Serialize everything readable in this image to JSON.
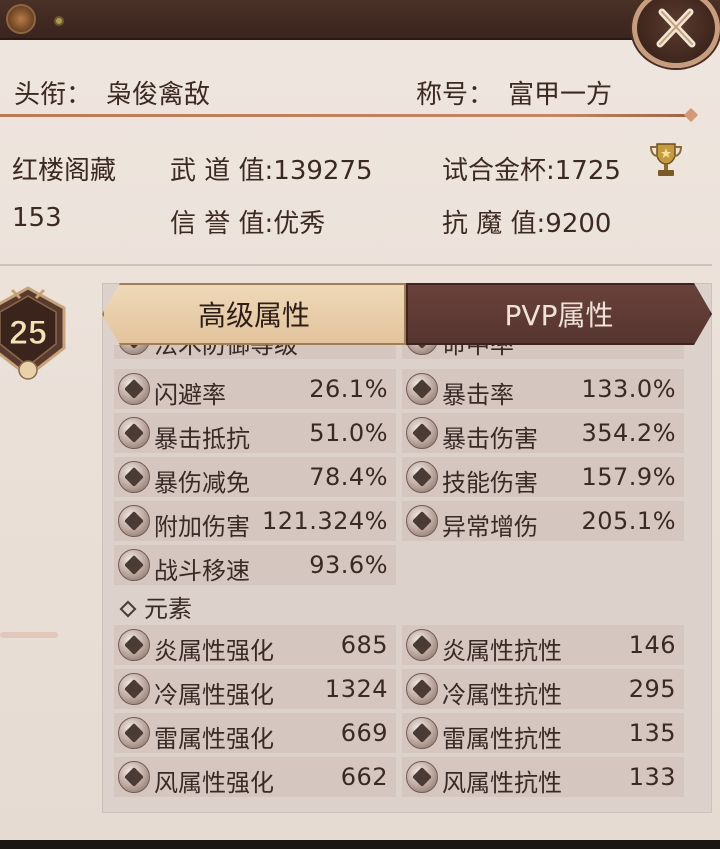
{
  "header": {
    "title_label": "头衔：",
    "title_value": "枭俊禽敌",
    "honor_label": "称号：",
    "honor_value": "富甲一方"
  },
  "info": {
    "row1": {
      "c1": "红楼阁藏",
      "c2": "武 道 值:139275",
      "c3": "试合金杯:1725"
    },
    "row2": {
      "c1": "153",
      "c2": "信 誉 值:优秀",
      "c3": "抗 魔 值:9200"
    }
  },
  "level": "25",
  "tabs": {
    "advanced": "高级属性",
    "pvp": "PVP属性"
  },
  "partial_row": {
    "left": "法术防御等级",
    "right": "命中率"
  },
  "stats": [
    {
      "left_label": "闪避率",
      "left_value": "26.1%",
      "right_label": "暴击率",
      "right_value": "133.0%"
    },
    {
      "left_label": "暴击抵抗",
      "left_value": "51.0%",
      "right_label": "暴击伤害",
      "right_value": "354.2%"
    },
    {
      "left_label": "暴伤减免",
      "left_value": "78.4%",
      "right_label": "技能伤害",
      "right_value": "157.9%"
    },
    {
      "left_label": "附加伤害",
      "left_value": "121.324%",
      "right_label": "异常增伤",
      "right_value": "205.1%"
    },
    {
      "left_label": "战斗移速",
      "left_value": "93.6%"
    }
  ],
  "element_section": "元素",
  "elements": [
    {
      "left_label": "炎属性强化",
      "left_value": "685",
      "right_label": "炎属性抗性",
      "right_value": "146"
    },
    {
      "left_label": "冷属性强化",
      "left_value": "1324",
      "right_label": "冷属性抗性",
      "right_value": "295"
    },
    {
      "left_label": "雷属性强化",
      "left_value": "669",
      "right_label": "雷属性抗性",
      "right_value": "135"
    },
    {
      "left_label": "风属性强化",
      "left_value": "662",
      "right_label": "风属性抗性",
      "right_value": "133"
    }
  ],
  "colors": {
    "tab_active": "#e3c39d",
    "tab_inactive": "#563530",
    "text": "#3c2a22"
  }
}
